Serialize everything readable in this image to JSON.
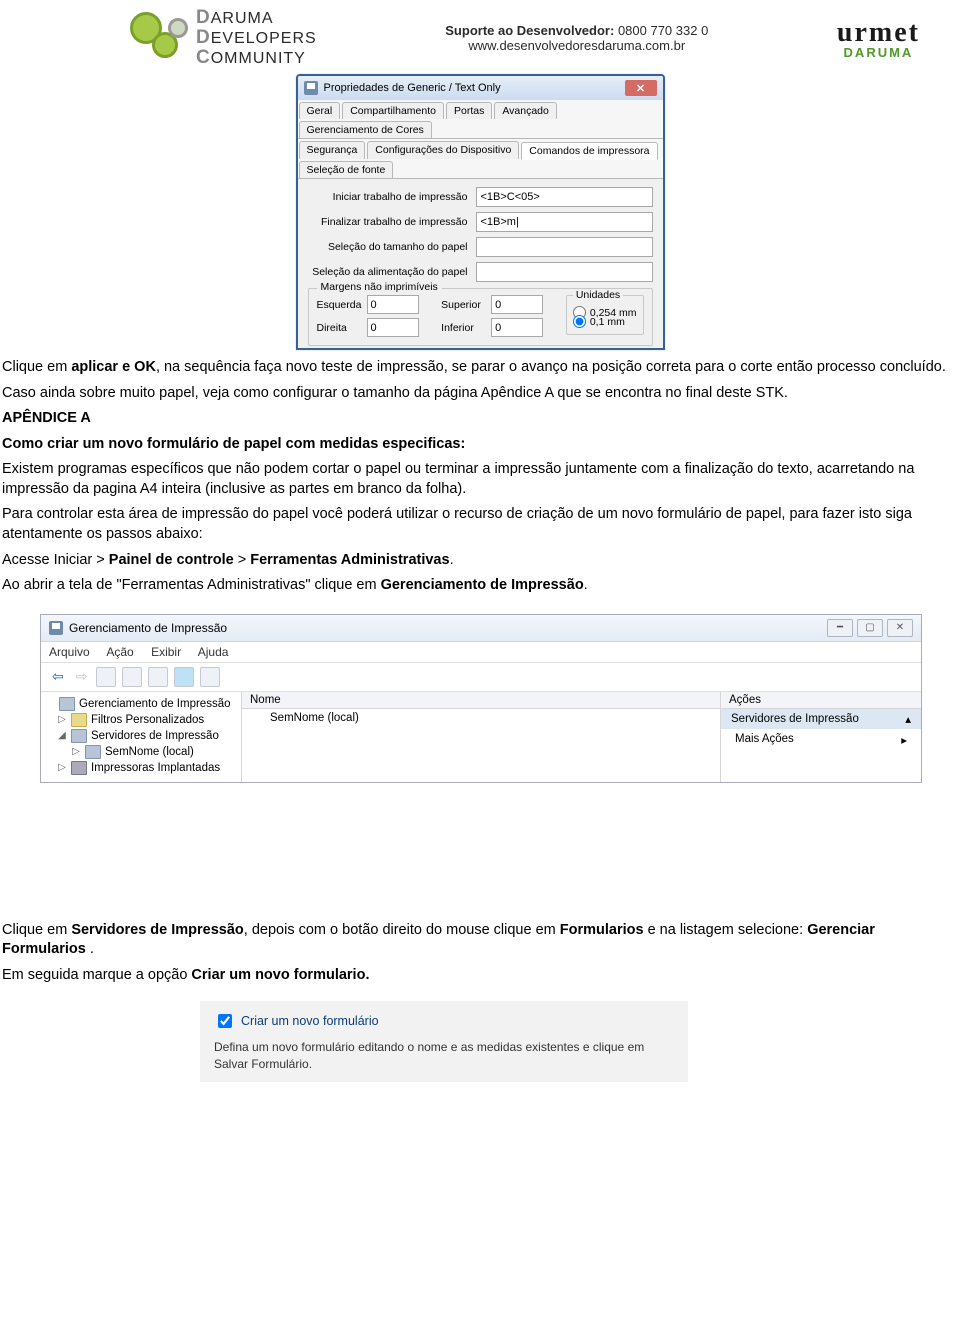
{
  "header": {
    "ddc": {
      "line1_big": "D",
      "line1_rest": "ARUMA",
      "line2_big": "D",
      "line2_rest": "EVELOPERS",
      "line3_big": "C",
      "line3_rest": "OMMUNITY"
    },
    "support_label": "Suporte ao Desenvolvedor:",
    "support_phone": "0800 770 332 0",
    "support_url": "www.desenvolvedoresdaruma.com.br",
    "urmet": {
      "word": "urmet",
      "brand": "DARUMA"
    }
  },
  "dialog1": {
    "title": "Propriedades de Generic / Text Only",
    "tabs_row1": [
      "Geral",
      "Compartilhamento",
      "Portas",
      "Avançado",
      "Gerenciamento de Cores"
    ],
    "tabs_row2": [
      "Segurança",
      "Configurações do Dispositivo",
      "Comandos de impressora",
      "Seleção de fonte"
    ],
    "active_tab_index": 2,
    "fields": {
      "begin_job_label": "Iniciar trabalho de impressão",
      "begin_job_value": "<1B>C<05>",
      "end_job_label": "Finalizar trabalho de impressão",
      "end_job_value": "<1B>m|",
      "paper_size_label": "Seleção do tamanho do papel",
      "paper_size_value": "",
      "paper_feed_label": "Seleção da alimentação do papel",
      "paper_feed_value": ""
    },
    "margins_legend": "Margens não imprimíveis",
    "margins": {
      "left_label": "Esquerda",
      "left": "0",
      "right_label": "Direita",
      "right": "0",
      "top_label": "Superior",
      "top": "0",
      "bottom_label": "Inferior",
      "bottom": "0"
    },
    "units": {
      "legend": "Unidades",
      "opt1": "0,254 mm",
      "opt2": "0,1 mm",
      "selected": "opt2"
    }
  },
  "article": {
    "p1a": "Clique em ",
    "p1b": "aplicar e OK",
    "p1c": ", na sequência faça novo teste de impressão, se parar o avanço na posição correta para o corte então processo concluído.",
    "p2": "Caso ainda sobre muito papel, veja como configurar o tamanho da página Apêndice A que se encontra no final deste STK.",
    "apx_head": "APÊNDICE A",
    "apx_sub": "Como criar um novo formulário de papel com medidas especificas:",
    "p3": "Existem programas específicos que não podem cortar o papel ou terminar a impressão juntamente com a finalização do texto, acarretando na impressão da pagina A4 inteira (inclusive as partes em branco da folha).",
    "p4": "Para controlar esta área de impressão do papel você poderá utilizar o recurso de criação de um novo formulário de papel, para fazer isto siga atentamente os passos abaixo:",
    "p5a": "Acesse Iniciar > ",
    "p5b": "Painel de controle",
    "p5c": "  > ",
    "p5d": "Ferramentas Administrativas",
    "p5e": ".",
    "p6a": "Ao abrir a tela de \"Ferramentas Administrativas\" clique em ",
    "p6b": "Gerenciamento de Impressão",
    "p6c": ".",
    "p7a": "Clique em ",
    "p7b": "Servidores de Impressão",
    "p7c": ", depois com o botão direito do mouse clique em ",
    "p7d": "Formularios",
    "p7e": " e na listagem selecione: ",
    "p7f": "Gerenciar Formularios ",
    "p7g": ".",
    "p8a": "Em seguida marque a opção ",
    "p8b": "Criar um novo formulario.",
    "p8c": ""
  },
  "mmc": {
    "title": "Gerenciamento de Impressão",
    "menus": [
      "Arquivo",
      "Ação",
      "Exibir",
      "Ajuda"
    ],
    "tree": {
      "root": "Gerenciamento de Impressão",
      "filters": "Filtros Personalizados",
      "servers": "Servidores de Impressão",
      "server1": "SemNome (local)",
      "deployed": "Impressoras Implantadas"
    },
    "mid_header": "Nome",
    "mid_row": "SemNome (local)",
    "right_header": "Ações",
    "right_group": "Servidores de Impressão",
    "right_item": "Mais Ações"
  },
  "cbx": {
    "label": "Criar um novo formulário",
    "desc": "Defina um novo formulário editando o nome e as medidas existentes e clique em Salvar Formulário."
  }
}
